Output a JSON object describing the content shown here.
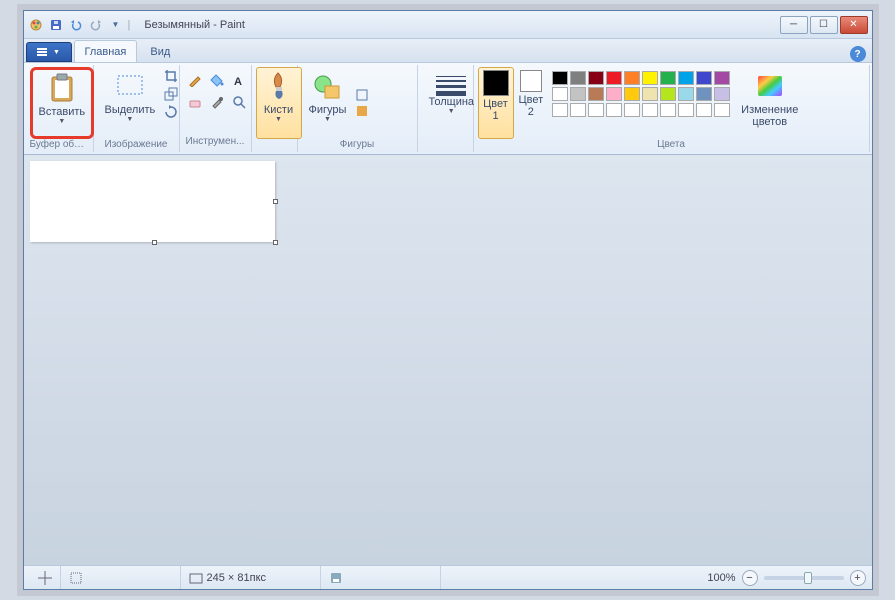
{
  "window": {
    "title": "Безымянный - Paint"
  },
  "tabs": {
    "home": "Главная",
    "view": "Вид"
  },
  "ribbon": {
    "clipboard": {
      "label": "Буфер обме...",
      "paste": "Вставить"
    },
    "image": {
      "label": "Изображение",
      "select": "Выделить"
    },
    "tools": {
      "label": "Инструмен..."
    },
    "brushes": {
      "label": "Кисти"
    },
    "shapes": {
      "label": "Фигуры",
      "btn": "Фигуры"
    },
    "thickness": {
      "label": "Толщина"
    },
    "color1": {
      "label": "Цвет\n1",
      "hex": "#000000"
    },
    "color2": {
      "label": "Цвет\n2",
      "hex": "#ffffff"
    },
    "colors_group": "Цвета",
    "edit_colors": "Изменение\nцветов",
    "palette": [
      [
        "#000000",
        "#7f7f7f",
        "#880015",
        "#ed1c24",
        "#ff7f27",
        "#fff200",
        "#22b14c",
        "#00a2e8",
        "#3f48cc",
        "#a349a4"
      ],
      [
        "#ffffff",
        "#c3c3c3",
        "#b97a57",
        "#ffaec9",
        "#ffc90e",
        "#efe4b0",
        "#b5e61d",
        "#99d9ea",
        "#7092be",
        "#c8bfe7"
      ],
      [
        "#ffffff",
        "#ffffff",
        "#ffffff",
        "#ffffff",
        "#ffffff",
        "#ffffff",
        "#ffffff",
        "#ffffff",
        "#ffffff",
        "#ffffff"
      ]
    ]
  },
  "status": {
    "dimensions": "245 × 81пкс",
    "zoom": "100%"
  }
}
